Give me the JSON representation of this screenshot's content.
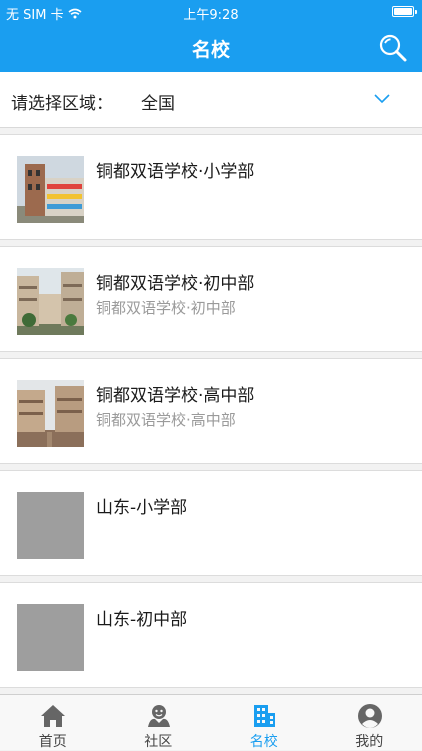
{
  "status_bar": {
    "carrier": "无 SIM 卡",
    "time": "上午9:28"
  },
  "nav": {
    "title": "名校",
    "search_icon": "search-icon"
  },
  "region": {
    "label": "请选择区域：",
    "value": "全国",
    "chevron_color": "#1a9ef0"
  },
  "schools": [
    {
      "name": "铜都双语学校·小学部",
      "subtitle": "",
      "thumb": "photo"
    },
    {
      "name": "铜都双语学校·初中部",
      "subtitle": "铜都双语学校·初中部",
      "thumb": "photo"
    },
    {
      "name": "铜都双语学校·高中部",
      "subtitle": "铜都双语学校·高中部",
      "thumb": "photo"
    },
    {
      "name": "山东-小学部",
      "subtitle": "",
      "thumb": "placeholder"
    },
    {
      "name": "山东-初中部",
      "subtitle": "",
      "thumb": "placeholder"
    }
  ],
  "tabs": [
    {
      "label": "首页",
      "icon": "home-icon"
    },
    {
      "label": "社区",
      "icon": "community-icon"
    },
    {
      "label": "名校",
      "icon": "school-building-icon",
      "active": true
    },
    {
      "label": "我的",
      "icon": "profile-icon"
    }
  ],
  "colors": {
    "primary": "#1a9ef0",
    "inactive_icon": "#666666",
    "placeholder": "#9e9e9e"
  }
}
